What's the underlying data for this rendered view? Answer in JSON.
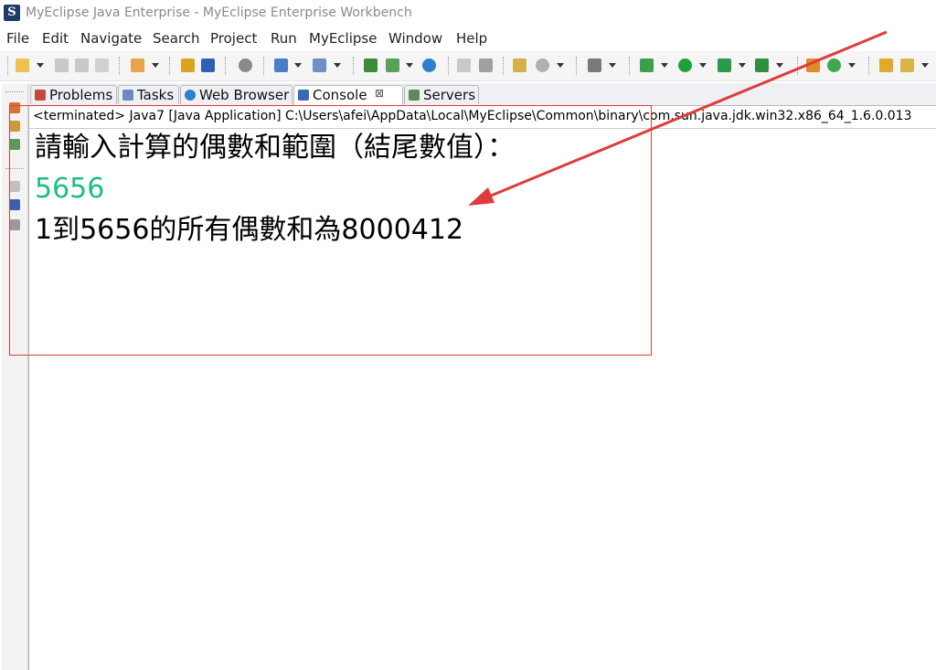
{
  "window": {
    "title": "MyEclipse Java Enterprise - MyEclipse Enterprise Workbench"
  },
  "menu": [
    "File",
    "Edit",
    "Navigate",
    "Search",
    "Project",
    "Run",
    "MyEclipse",
    "Window",
    "Help"
  ],
  "tabs": [
    {
      "label": "Problems",
      "icon": "problems-icon"
    },
    {
      "label": "Tasks",
      "icon": "tasks-icon"
    },
    {
      "label": "Web Browser",
      "icon": "globe-icon"
    },
    {
      "label": "Console",
      "icon": "console-icon",
      "active": true,
      "close": "⊠"
    },
    {
      "label": "Servers",
      "icon": "servers-icon"
    }
  ],
  "console": {
    "header": "<terminated> Java7 [Java Application] C:\\Users\\afei\\AppData\\Local\\MyEclipse\\Common\\binary\\com.sun.java.jdk.win32.x86_64_1.6.0.013",
    "lines": [
      {
        "text": "請輸入計算的偶數和範圍（結尾數值）：",
        "color": "#000000"
      },
      {
        "text": "5656",
        "color": "#1bbf7f"
      },
      {
        "text": "1到5656的所有偶數和為8000412",
        "color": "#000000"
      }
    ]
  },
  "colors": {
    "annotation": "#e03b3b",
    "input_text": "#1bbf7f"
  }
}
